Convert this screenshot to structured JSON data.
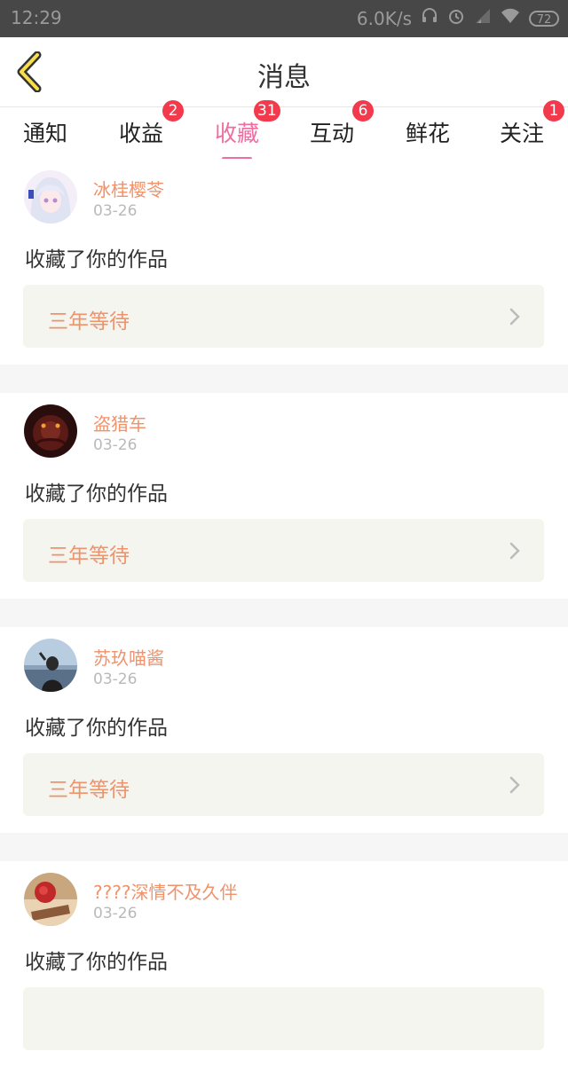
{
  "status_bar": {
    "time": "12:29",
    "network_speed": "6.0K/s",
    "battery": "72",
    "icons": [
      "headset-icon",
      "alarm-icon",
      "signal-icon",
      "wifi-icon",
      "battery-icon"
    ]
  },
  "header": {
    "title": "消息",
    "back_icon": "chevron-left-icon"
  },
  "tabs": [
    {
      "label": "通知",
      "badge": ""
    },
    {
      "label": "收益",
      "badge": "2"
    },
    {
      "label": "收藏",
      "badge": "31",
      "active": true
    },
    {
      "label": "互动",
      "badge": "6"
    },
    {
      "label": "鲜花",
      "badge": ""
    },
    {
      "label": "关注",
      "badge": "1"
    }
  ],
  "colors": {
    "accent": "#ef6da0",
    "badge": "#f23a4c",
    "username": "#f0926a",
    "work_bg": "#f5f5f0"
  },
  "items": [
    {
      "username": "冰桂樱苓",
      "date": "03-26",
      "message": "收藏了你的作品",
      "work_title": "三年等待"
    },
    {
      "username": "盗猎车",
      "date": "03-26",
      "message": "收藏了你的作品",
      "work_title": "三年等待"
    },
    {
      "username": "苏玖喵酱",
      "date": "03-26",
      "message": "收藏了你的作品",
      "work_title": "三年等待"
    },
    {
      "username": "????深情不及久伴",
      "date": "03-26",
      "message": "收藏了你的作品",
      "work_title": ""
    }
  ]
}
